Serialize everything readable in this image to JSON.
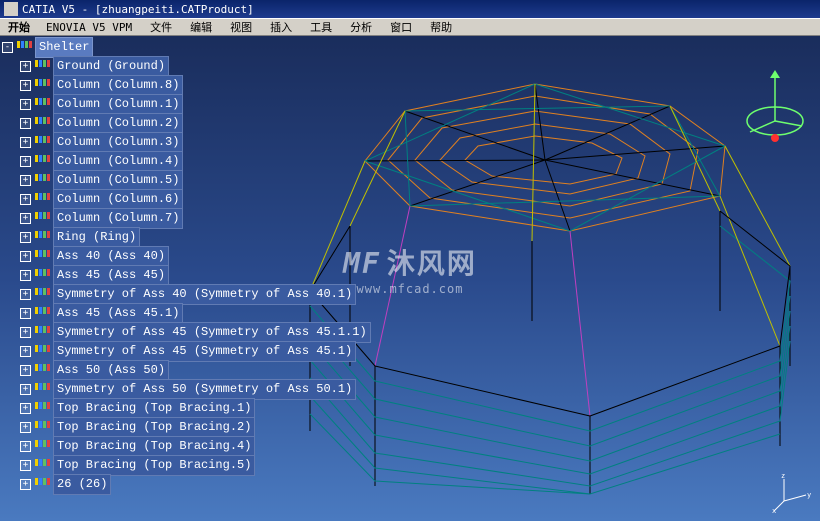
{
  "title": "CATIA V5 - [zhuangpeiti.CATProduct]",
  "menu": {
    "start": "开始",
    "enovia": "ENOVIA V5 VPM",
    "items": [
      "文件",
      "编辑",
      "视图",
      "插入",
      "工具",
      "分析",
      "窗口",
      "帮助"
    ]
  },
  "tree": [
    {
      "level": 0,
      "exp": "-",
      "label": "Shelter",
      "root": true
    },
    {
      "level": 1,
      "exp": "+",
      "label": "Ground (Ground)"
    },
    {
      "level": 1,
      "exp": "+",
      "label": "Column (Column.8)"
    },
    {
      "level": 1,
      "exp": "+",
      "label": "Column (Column.1)"
    },
    {
      "level": 1,
      "exp": "+",
      "label": "Column (Column.2)"
    },
    {
      "level": 1,
      "exp": "+",
      "label": "Column (Column.3)"
    },
    {
      "level": 1,
      "exp": "+",
      "label": "Column (Column.4)"
    },
    {
      "level": 1,
      "exp": "+",
      "label": "Column (Column.5)"
    },
    {
      "level": 1,
      "exp": "+",
      "label": "Column (Column.6)"
    },
    {
      "level": 1,
      "exp": "+",
      "label": "Column (Column.7)"
    },
    {
      "level": 1,
      "exp": "+",
      "label": "Ring (Ring)"
    },
    {
      "level": 1,
      "exp": "+",
      "label": "Ass 40 (Ass 40)"
    },
    {
      "level": 1,
      "exp": "+",
      "label": "Ass 45 (Ass 45)"
    },
    {
      "level": 1,
      "exp": "+",
      "label": "Symmetry of Ass 40 (Symmetry of Ass 40.1)"
    },
    {
      "level": 1,
      "exp": "+",
      "label": "Ass 45 (Ass 45.1)"
    },
    {
      "level": 1,
      "exp": "+",
      "label": "Symmetry of Ass 45 (Symmetry of Ass 45.1.1)"
    },
    {
      "level": 1,
      "exp": "+",
      "label": "Symmetry of Ass 45 (Symmetry of Ass 45.1)"
    },
    {
      "level": 1,
      "exp": "+",
      "label": "Ass 50 (Ass 50)"
    },
    {
      "level": 1,
      "exp": "+",
      "label": "Symmetry of Ass 50 (Symmetry of Ass 50.1)"
    },
    {
      "level": 1,
      "exp": "+",
      "label": "Top Bracing (Top Bracing.1)"
    },
    {
      "level": 1,
      "exp": "+",
      "label": "Top Bracing (Top Bracing.2)"
    },
    {
      "level": 1,
      "exp": "+",
      "label": "Top Bracing (Top Bracing.4)"
    },
    {
      "level": 1,
      "exp": "+",
      "label": "Top Bracing (Top Bracing.5)"
    },
    {
      "level": 1,
      "exp": "+",
      "label": "26 (26)"
    }
  ],
  "watermark": {
    "cn": "沐风网",
    "en": "www.mfcad.com",
    "logo": "MF"
  },
  "axis": {
    "x": "x",
    "y": "y",
    "z": "z"
  }
}
